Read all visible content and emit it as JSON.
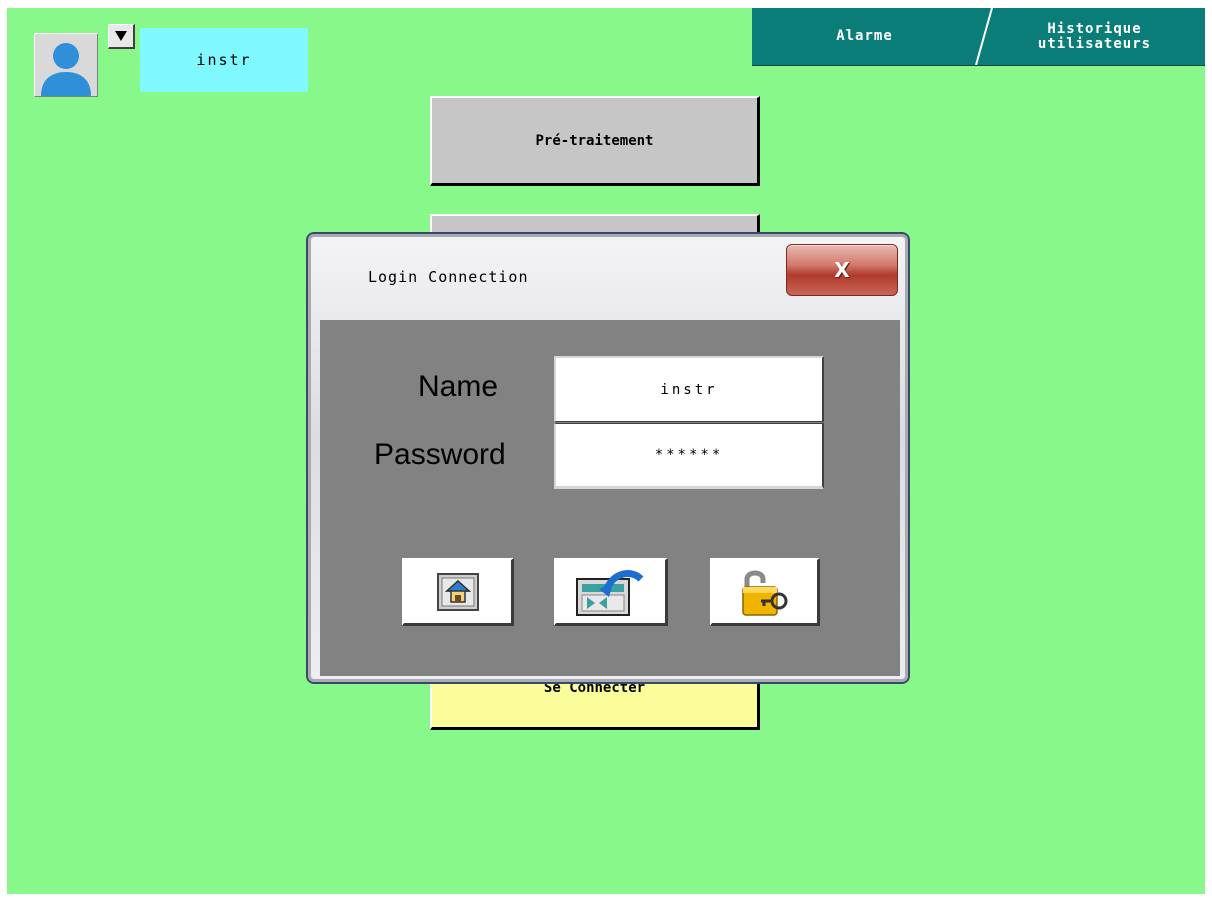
{
  "user": {
    "name": "instr",
    "avatar_icon": "user-avatar-icon",
    "dropdown_icon": "triangle-down-icon"
  },
  "tabs": {
    "alarm": "Alarme",
    "history_line1": "Historique",
    "history_line2": "utilisateurs"
  },
  "menu": {
    "pretraitement": "Pré-traitement",
    "middle": "",
    "connect": "Se Connecter"
  },
  "dialog": {
    "title": "Login Connection",
    "close_label": "X",
    "name_label": "Name",
    "name_value": "instr",
    "password_label": "Password",
    "password_value": "******",
    "buttons": [
      {
        "icon": "home-icon"
      },
      {
        "icon": "return-screen-icon"
      },
      {
        "icon": "unlock-key-icon"
      }
    ]
  },
  "colors": {
    "background": "#88f88b",
    "user_field": "#7ff8ff",
    "tab_bar": "#0b7d79",
    "menu_button": "#c6c6c6",
    "connect_button": "#fbfc9a",
    "dialog_body": "#828282"
  }
}
